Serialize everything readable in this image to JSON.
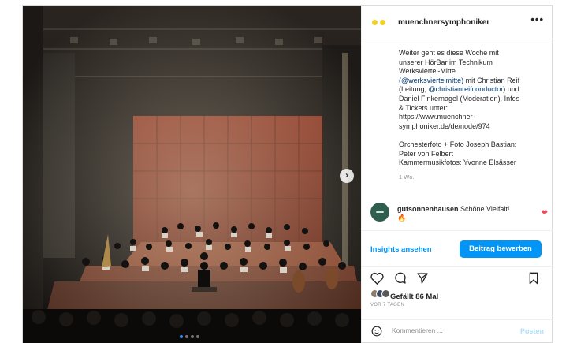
{
  "post": {
    "username": "muenchnersymphoniker",
    "more_label": "•••",
    "caption": {
      "text_1": "Weiter geht es diese Woche mit\nunserer HörBar im Technikum\nWerksviertel-Mitte\n",
      "mention_1": "(@werksviertelmitte)",
      "text_2": " mit Christian Reif\n(Leitung; ",
      "mention_2": "@christianreifconductor",
      "text_3": ") und\nDaniel Finkernagel (Moderation). Infos\n& Tickets unter:\nhttps://www.muenchner-\nsymphoniker.de/de/node/974\n\nOrchesterfoto + Foto Joseph Bastian:\nPeter von Felbert\nKammermusikfotos: Yvonne Elsässer",
      "time": "1 Wo."
    },
    "comment": {
      "username": "gutsonnenhausen",
      "text": " Schöne Vielfalt!",
      "emoji": "🔥"
    },
    "insights_label": "Insights ansehen",
    "boost_label": "Beitrag bewerben",
    "likes_label": "Gefällt 86 Mal",
    "date_label": "VOR 7 TAGEN",
    "comment_placeholder": "Kommentieren ...",
    "post_label": "Posten"
  },
  "carousel": {
    "current_index": 1,
    "total": 4
  },
  "colors": {
    "accent": "#0095f6",
    "like_red": "#ed4956",
    "avatar_yellow": "#f3d026"
  },
  "icons": [
    "chevron-right-icon",
    "more-icon",
    "heart-icon",
    "comment-icon",
    "share-icon",
    "bookmark-icon",
    "emoji-icon"
  ]
}
